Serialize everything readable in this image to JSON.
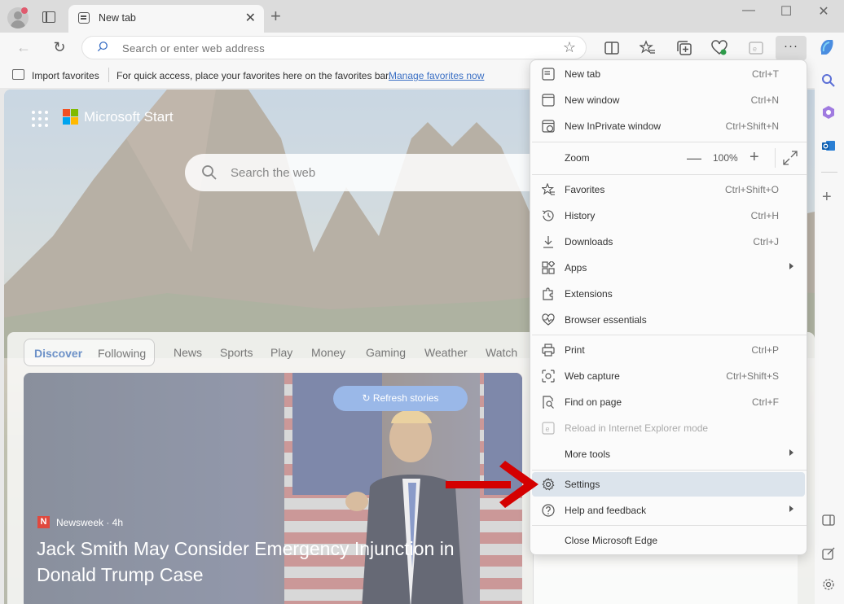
{
  "tab": {
    "title": "New tab"
  },
  "address_bar": {
    "placeholder": "Search or enter web address"
  },
  "favorites_bar": {
    "import_label": "Import favorites",
    "hint": "For quick access, place your favorites here on the favorites bar.",
    "manage_link": "Manage favorites now"
  },
  "page": {
    "brand": "Microsoft Start",
    "search_placeholder": "Search the web",
    "feed_tabs": [
      "Discover",
      "Following"
    ],
    "nav_items": [
      "News",
      "Sports",
      "Play",
      "Money",
      "Gaming",
      "Weather",
      "Watch"
    ],
    "refresh_label": "Refresh stories",
    "story": {
      "source_logo": "N",
      "source": "Newsweek · 4h",
      "headline": "Jack Smith May Consider Emergency Injunction in Donald Trump Case"
    }
  },
  "menu": {
    "new_tab": {
      "label": "New tab",
      "shortcut": "Ctrl+T"
    },
    "new_window": {
      "label": "New window",
      "shortcut": "Ctrl+N"
    },
    "new_inprivate": {
      "label": "New InPrivate window",
      "shortcut": "Ctrl+Shift+N"
    },
    "zoom": {
      "label": "Zoom",
      "value": "100%"
    },
    "favorites": {
      "label": "Favorites",
      "shortcut": "Ctrl+Shift+O"
    },
    "history": {
      "label": "History",
      "shortcut": "Ctrl+H"
    },
    "downloads": {
      "label": "Downloads",
      "shortcut": "Ctrl+J"
    },
    "apps": {
      "label": "Apps"
    },
    "extensions": {
      "label": "Extensions"
    },
    "browser_essentials": {
      "label": "Browser essentials"
    },
    "print": {
      "label": "Print",
      "shortcut": "Ctrl+P"
    },
    "web_capture": {
      "label": "Web capture",
      "shortcut": "Ctrl+Shift+S"
    },
    "find_on_page": {
      "label": "Find on page",
      "shortcut": "Ctrl+F"
    },
    "reload_ie": {
      "label": "Reload in Internet Explorer mode"
    },
    "more_tools": {
      "label": "More tools"
    },
    "settings": {
      "label": "Settings"
    },
    "help": {
      "label": "Help and feedback"
    },
    "close": {
      "label": "Close Microsoft Edge"
    }
  },
  "colors": {
    "accent": "#3a6fc4",
    "selected_row": "#dce4ec",
    "annotation_arrow": "#d40000"
  }
}
